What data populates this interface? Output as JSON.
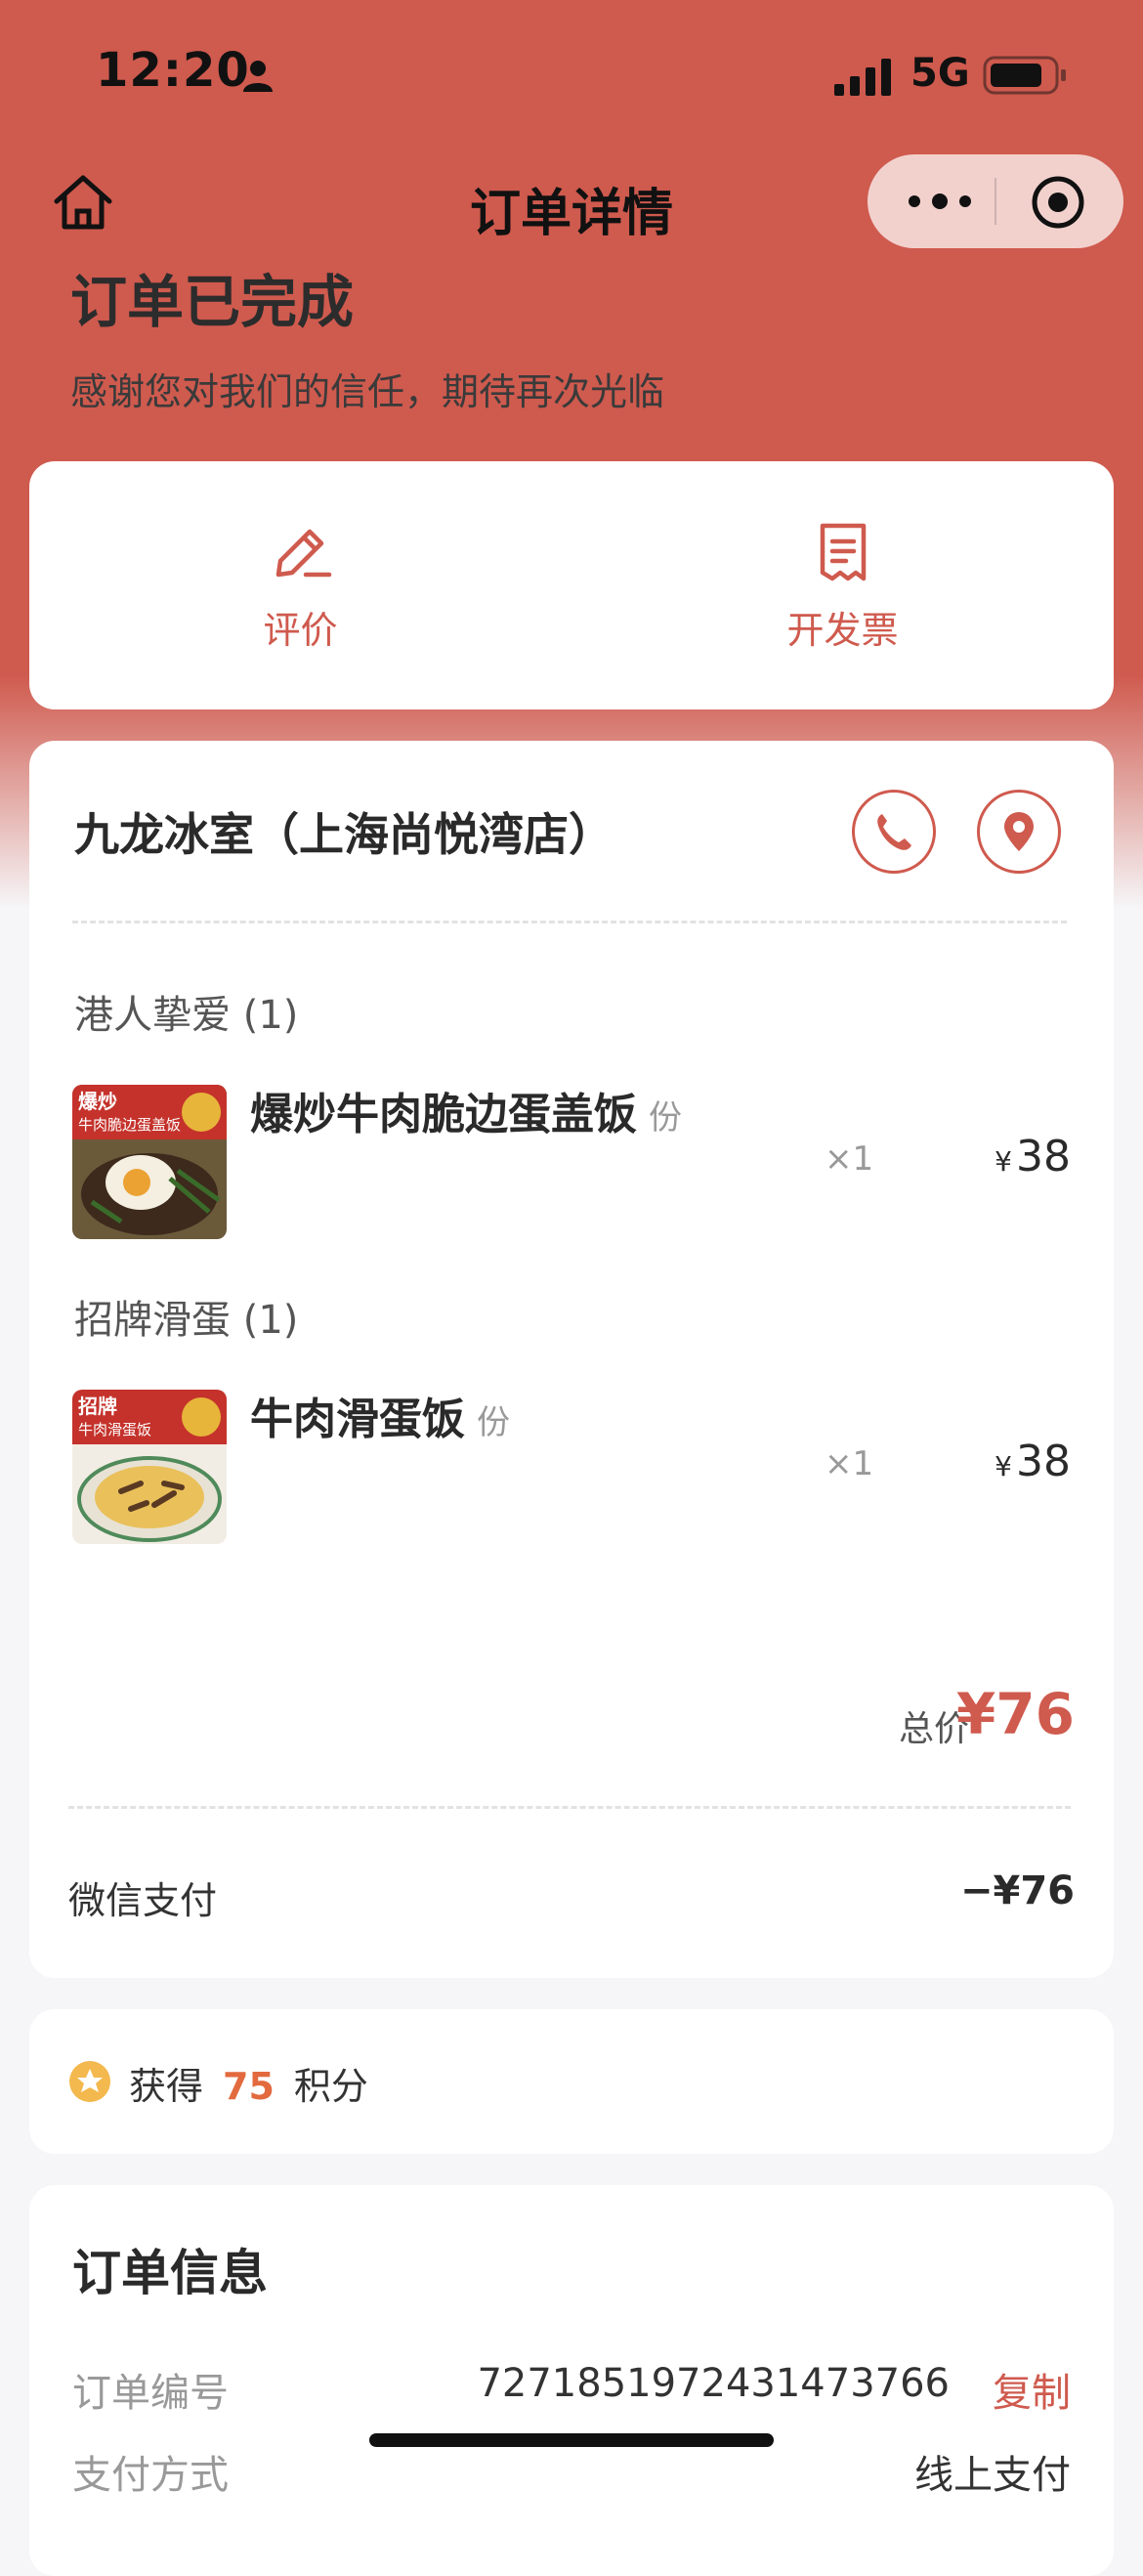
{
  "status_bar": {
    "time": "12:20",
    "network": "5G"
  },
  "nav": {
    "title": "订单详情"
  },
  "order_status": {
    "title": "订单已完成",
    "subtitle": "感谢您对我们的信任，期待再次光临"
  },
  "actions": [
    {
      "label": "评价",
      "icon": "edit-icon"
    },
    {
      "label": "开发票",
      "icon": "invoice-icon"
    }
  ],
  "store": {
    "name": "九龙冰室（上海尚悦湾店）"
  },
  "categories": [
    {
      "label": "港人挚爱 (1)",
      "items": [
        {
          "name": "爆炒牛肉脆边蛋盖饭",
          "unit": "份",
          "qty": "×1",
          "currency": "¥",
          "price": "38",
          "image_caption": "爆炒\n牛肉脆边蛋盖饭"
        }
      ]
    },
    {
      "label": "招牌滑蛋 (1)",
      "items": [
        {
          "name": "牛肉滑蛋饭",
          "unit": "份",
          "qty": "×1",
          "currency": "¥",
          "price": "38",
          "image_caption": "招牌\n牛肉滑蛋饭"
        }
      ]
    }
  ],
  "summary": {
    "total_label": "总价",
    "total_value": "¥76",
    "pay_method": "微信支付",
    "pay_amount": "−¥76"
  },
  "points": {
    "prefix": "获得",
    "value": "75",
    "suffix": "积分"
  },
  "order_info": {
    "title": "订单信息",
    "order_no_label": "订单编号",
    "order_no": "7271851972431473766",
    "copy_label": "复制",
    "pay_type_label": "支付方式",
    "pay_type": "线上支付"
  },
  "colors": {
    "brand": "#cf5a4e",
    "points": "#e26a3e"
  }
}
